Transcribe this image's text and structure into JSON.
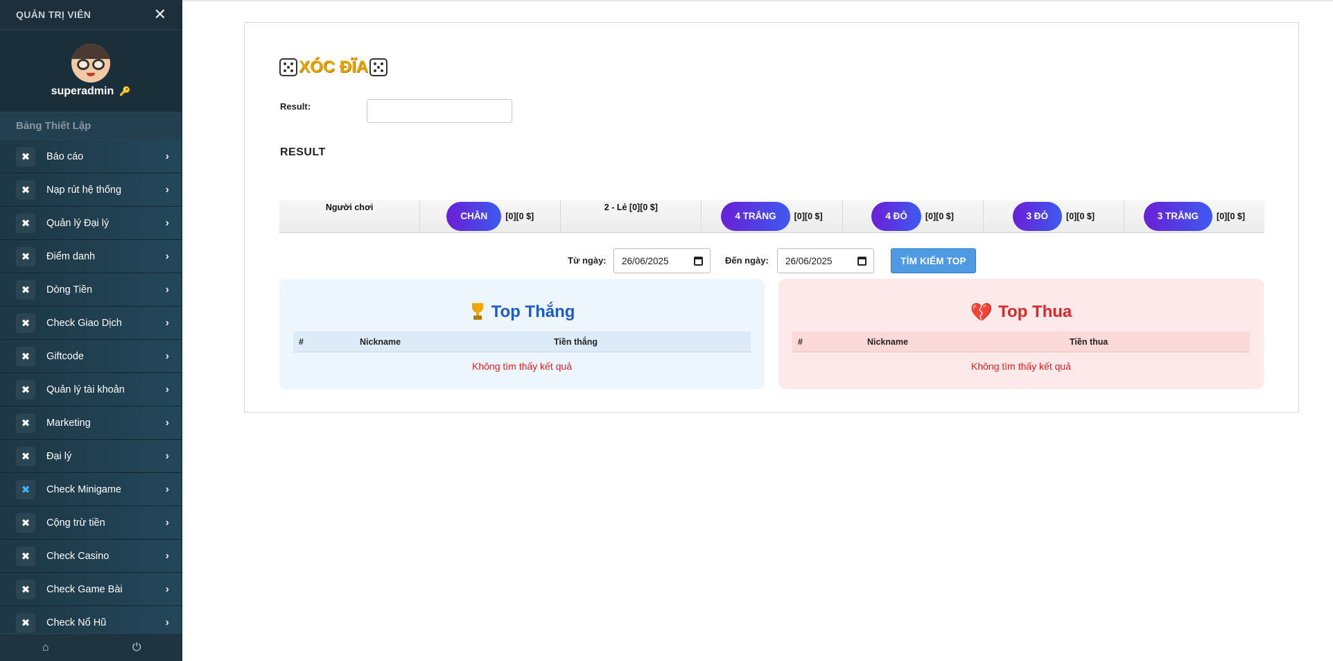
{
  "sidebar": {
    "title": "QUẢN TRỊ VIÊN",
    "username": "superadmin",
    "section": "Bảng Thiết Lập",
    "items": [
      {
        "label": "Báo cáo"
      },
      {
        "label": "Nạp rút hệ thống"
      },
      {
        "label": "Quản lý Đại lý"
      },
      {
        "label": "Điểm danh"
      },
      {
        "label": "Dòng Tiền"
      },
      {
        "label": "Check Giao Dịch"
      },
      {
        "label": "Giftcode"
      },
      {
        "label": "Quản lý tài khoản"
      },
      {
        "label": "Marketing"
      },
      {
        "label": "Đại lý"
      },
      {
        "label": "Check Minigame"
      },
      {
        "label": "Cộng trừ tiền"
      },
      {
        "label": "Check Casino"
      },
      {
        "label": "Check Game Bài"
      },
      {
        "label": "Check Nổ Hũ"
      }
    ],
    "footer": {
      "home_icon": "home-icon",
      "power_icon": "power-icon"
    }
  },
  "main": {
    "game_title": "XÓC ĐĨA",
    "result_label": "Result:",
    "result_value": "",
    "result_heading": "RESULT",
    "stats": {
      "player_label": "Người chơi",
      "chan_label": "CHẴN",
      "chan_count": "[0][0 $]",
      "le_label": "2 - Lẻ [0][0 $]",
      "four_white_label": "4 TRẮNG",
      "four_white_count": "[0][0 $]",
      "four_red_label": "4 ĐỎ",
      "four_red_count": "[0][0 $]",
      "three_red_label": "3 ĐỎ",
      "three_red_count": "[0][0 $]",
      "three_white_label": "3 TRẮNG",
      "three_white_count": "[0][0 $]"
    },
    "filters": {
      "from_label": "Từ ngày:",
      "from_value": "26/06/2025",
      "to_label": "Đến ngày:",
      "to_value": "26/06/2025",
      "search_button": "TÌM KIẾM TOP"
    },
    "top_win": {
      "title": "Top Thắng",
      "col_index": "#",
      "col_nickname": "Nickname",
      "col_amount": "Tiền thắng",
      "empty": "Không tìm thấy kết quả"
    },
    "top_lose": {
      "title": "Top Thua",
      "col_index": "#",
      "col_nickname": "Nickname",
      "col_amount": "Tiền thua",
      "empty": "Không tìm thấy kết quả"
    }
  }
}
